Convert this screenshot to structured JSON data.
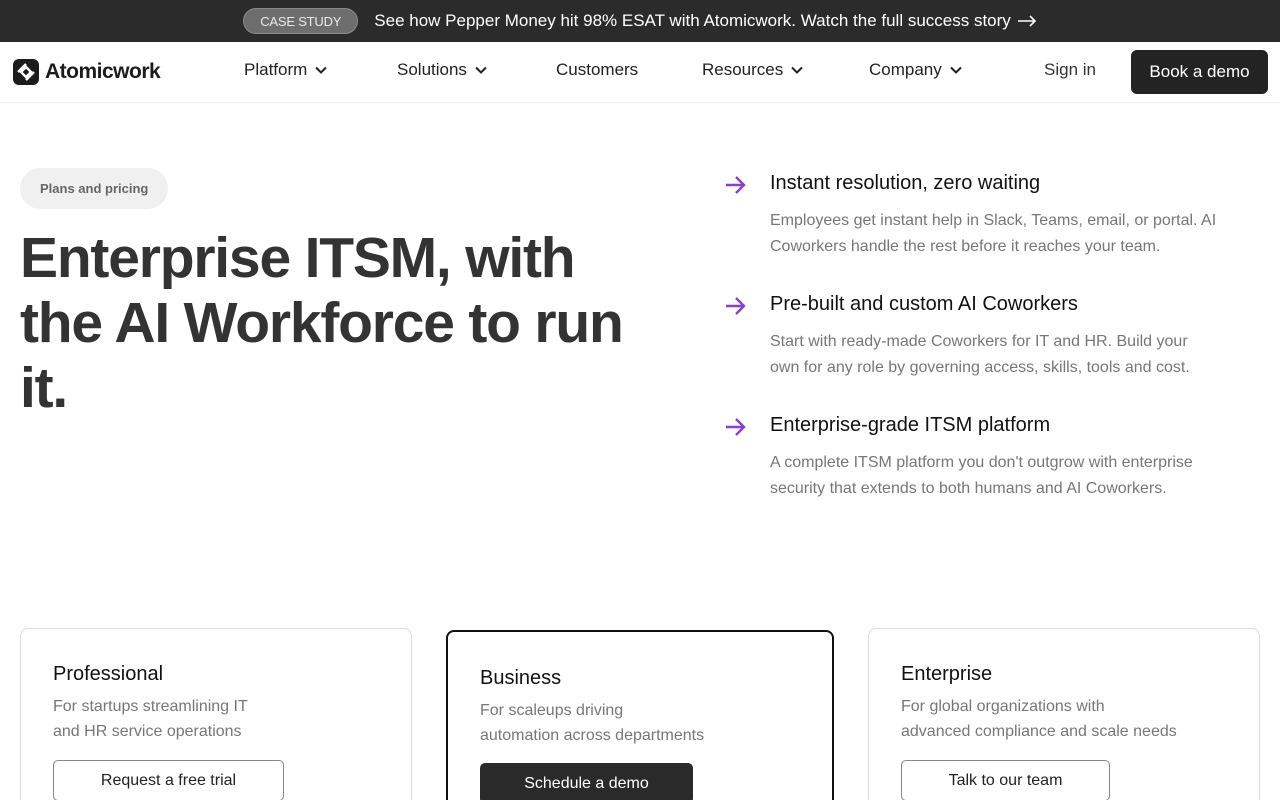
{
  "announcement": {
    "badge": "CASE STUDY",
    "text": "See how Pepper Money hit 98% ESAT with Atomicwork. Watch the full success story"
  },
  "nav": {
    "logo": "Atomicwork",
    "items": [
      {
        "label": "Platform",
        "dropdown": true
      },
      {
        "label": "Solutions",
        "dropdown": true
      },
      {
        "label": "Customers",
        "dropdown": false
      },
      {
        "label": "Resources",
        "dropdown": true
      },
      {
        "label": "Company",
        "dropdown": true
      }
    ],
    "sign_in": "Sign in",
    "cta": "Book a demo"
  },
  "hero": {
    "pill": "Plans and pricing",
    "title": "Enterprise ITSM, with the AI Workforce to run it."
  },
  "features": [
    {
      "title": "Instant resolution, zero waiting",
      "desc": "Employees get instant help in Slack, Teams, email, or portal. AI Coworkers handle the rest before it reaches your team."
    },
    {
      "title": "Pre-built and custom AI Coworkers",
      "desc": "Start with ready-made Coworkers for IT and HR. Build your own for any role by governing access, skills, tools and cost."
    },
    {
      "title": "Enterprise-grade ITSM platform",
      "desc": "A complete ITSM platform you don't outgrow with enterprise security that extends to both humans and AI Coworkers."
    }
  ],
  "plans": [
    {
      "name": "Professional",
      "desc_line1": "For startups streamlining IT",
      "desc_line2": "and HR service operations",
      "cta": "Request a free trial"
    },
    {
      "name": "Business",
      "desc_line1": "For scaleups driving",
      "desc_line2": "automation across departments",
      "cta": "Schedule a demo"
    },
    {
      "name": "Enterprise",
      "desc_line1": "For global organizations with",
      "desc_line2": "advanced compliance and scale needs",
      "cta": "Talk to our team"
    }
  ],
  "colors": {
    "accent_arrow": "#8a3fd1",
    "dark": "#232323"
  }
}
